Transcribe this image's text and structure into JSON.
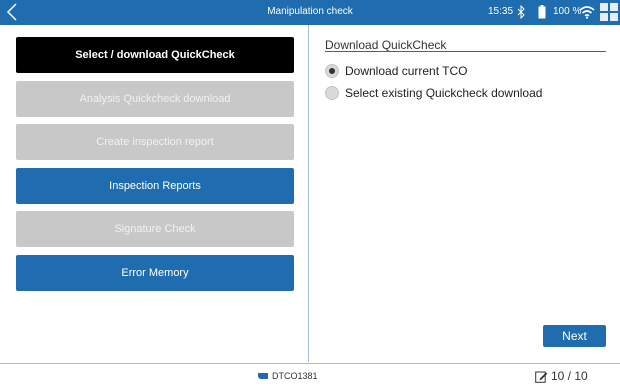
{
  "header": {
    "title": "Manipulation check",
    "time": "15:35",
    "battery_pct": "100 %"
  },
  "menu": {
    "items": [
      {
        "label": "Select / download QuickCheck",
        "state": "active"
      },
      {
        "label": "Analysis Quickcheck download",
        "state": "disabled"
      },
      {
        "label": "Create inspection report",
        "state": "disabled"
      },
      {
        "label": "Inspection Reports",
        "state": "enabled"
      },
      {
        "label": "Signature Check",
        "state": "disabled"
      },
      {
        "label": "Error Memory",
        "state": "enabled"
      }
    ]
  },
  "panel": {
    "title": "Download QuickCheck",
    "options": [
      {
        "label": "Download current TCO",
        "checked": true
      },
      {
        "label": "Select existing Quickcheck download",
        "checked": false
      }
    ],
    "next_label": "Next"
  },
  "footer": {
    "device": "DTCO1381",
    "pages": "10 / 10"
  },
  "colors": {
    "accent": "#1f6dae",
    "active": "#000000",
    "disabled": "#c8c8c8"
  },
  "icons": [
    "back-icon",
    "bluetooth-icon",
    "battery-icon",
    "wifi-icon",
    "app-grid-icon",
    "tachograph-icon",
    "edit-icon"
  ]
}
